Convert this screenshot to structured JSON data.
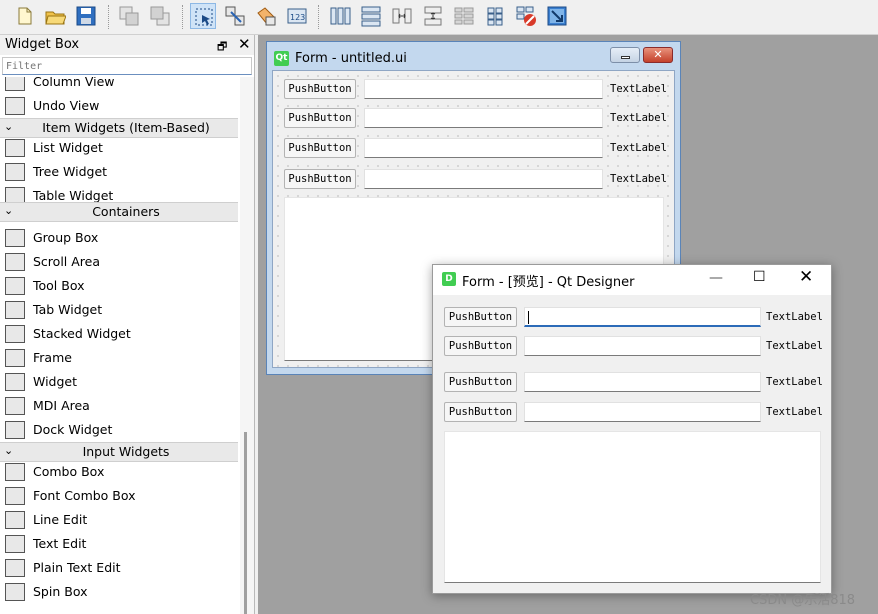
{
  "toolbar": {
    "buttons": [
      "new-form-icon",
      "open-form-icon",
      "save-form-icon",
      "bring-to-front-icon",
      "send-to-back-icon",
      "edit-widgets-icon",
      "edit-signals-slots-icon",
      "edit-buddies-icon",
      "edit-tab-order-icon",
      "layout-horizontally-icon",
      "layout-vertically-icon",
      "layout-horizontal-splitter-icon",
      "layout-vertical-splitter-icon",
      "layout-in-form-layout-icon",
      "layout-in-grid-icon",
      "break-layout-icon",
      "adjust-size-icon"
    ]
  },
  "widget_box": {
    "title": "Widget Box",
    "float_icon": "🗗",
    "close_icon": "✕",
    "filter_placeholder": "Filter",
    "groups": [
      {
        "type": "item",
        "label": "Column View",
        "icon": "column-view-icon"
      },
      {
        "type": "item",
        "label": "Undo View",
        "icon": "undo-view-icon"
      },
      {
        "type": "category",
        "label": "Item Widgets (Item-Based)"
      },
      {
        "type": "item",
        "label": "List Widget",
        "icon": "list-widget-icon"
      },
      {
        "type": "item",
        "label": "Tree Widget",
        "icon": "tree-widget-icon"
      },
      {
        "type": "item",
        "label": "Table Widget",
        "icon": "table-widget-icon"
      },
      {
        "type": "category",
        "label": "Containers"
      },
      {
        "type": "item",
        "label": "Group Box",
        "icon": "group-box-icon"
      },
      {
        "type": "item",
        "label": "Scroll Area",
        "icon": "scroll-area-icon"
      },
      {
        "type": "item",
        "label": "Tool Box",
        "icon": "tool-box-icon"
      },
      {
        "type": "item",
        "label": "Tab Widget",
        "icon": "tab-widget-icon"
      },
      {
        "type": "item",
        "label": "Stacked Widget",
        "icon": "stacked-widget-icon"
      },
      {
        "type": "item",
        "label": "Frame",
        "icon": "frame-icon"
      },
      {
        "type": "item",
        "label": "Widget",
        "icon": "widget-icon"
      },
      {
        "type": "item",
        "label": "MDI Area",
        "icon": "mdi-area-icon"
      },
      {
        "type": "item",
        "label": "Dock Widget",
        "icon": "dock-widget-icon"
      },
      {
        "type": "category",
        "label": "Input Widgets"
      },
      {
        "type": "item",
        "label": "Combo Box",
        "icon": "combo-box-icon"
      },
      {
        "type": "item",
        "label": "Font Combo Box",
        "icon": "font-combo-box-icon"
      },
      {
        "type": "item",
        "label": "Line Edit",
        "icon": "line-edit-icon"
      },
      {
        "type": "item",
        "label": "Text Edit",
        "icon": "text-edit-icon"
      },
      {
        "type": "item",
        "label": "Plain Text Edit",
        "icon": "plain-text-edit-icon"
      },
      {
        "type": "item",
        "label": "Spin Box",
        "icon": "spin-box-icon"
      }
    ]
  },
  "form": {
    "qt_badge": "Qt",
    "title": "Form - untitled.ui",
    "close_glyph": "✕",
    "rows": [
      {
        "button": "PushButton",
        "label": "TextLabel"
      },
      {
        "button": "PushButton",
        "label": "TextLabel"
      },
      {
        "button": "PushButton",
        "label": "TextLabel"
      },
      {
        "button": "PushButton",
        "label": "TextLabel"
      }
    ]
  },
  "preview": {
    "icon_letter": "D",
    "title": "Form - [预览] - Qt Designer",
    "min_glyph": "—",
    "max_glyph": "☐",
    "close_glyph": "✕",
    "rows": [
      {
        "button": "PushButton",
        "label": "TextLabel",
        "focused": true
      },
      {
        "button": "PushButton",
        "label": "TextLabel",
        "focused": false
      },
      {
        "button": "PushButton",
        "label": "TextLabel",
        "focused": false
      },
      {
        "button": "PushButton",
        "label": "TextLabel",
        "focused": false
      }
    ]
  },
  "watermark": "CSDN @乐活818"
}
